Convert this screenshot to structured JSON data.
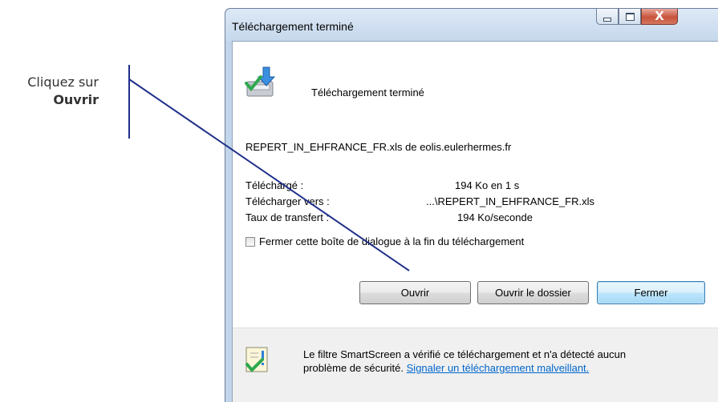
{
  "annotation": {
    "line1": "Cliquez sur",
    "line2": "Ouvrir"
  },
  "dialog": {
    "title": "Téléchargement terminé",
    "header_text": "Téléchargement terminé",
    "filename": "REPERT_IN_EHFRANCE_FR.xls de eolis.eulerhermes.fr",
    "info": [
      {
        "label": "Téléchargé :",
        "value": "194 Ko en 1 s"
      },
      {
        "label": "Télécharger vers :",
        "value": "...\\REPERT_IN_EHFRANCE_FR.xls"
      },
      {
        "label": "Taux de transfert :",
        "value": "194 Ko/seconde"
      }
    ],
    "close_on_finish_label": "Fermer cette boîte de dialogue à la fin du téléchargement",
    "close_on_finish_checked": false,
    "buttons": {
      "open": "Ouvrir",
      "open_folder": "Ouvrir le dossier",
      "close": "Fermer"
    },
    "footer": {
      "line1": "Le filtre SmartScreen a vérifié ce téléchargement et n'a détecté aucun",
      "line2_text": "problème de sécurité.",
      "line2_link": "Signaler un téléchargement malveillant."
    },
    "window_controls": {
      "close_glyph": "X"
    }
  },
  "colors": {
    "annotation_line": "#1e2f8a",
    "link": "#0066cc",
    "close_button": "#c8533b"
  }
}
